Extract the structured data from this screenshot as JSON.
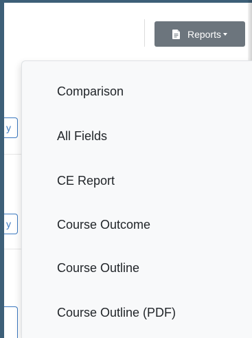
{
  "toolbar": {
    "reports_label": "Reports",
    "reports_icon": "document-icon",
    "reports_caret_icon": "caret-down-icon",
    "button_color": "#6c757d"
  },
  "left_partial": {
    "chip_1_text": "y",
    "chip_2_text": "y",
    "chip_3_text": "",
    "accent_color": "#3a78c0"
  },
  "dropdown": {
    "items": [
      {
        "label": "Comparison"
      },
      {
        "label": "All Fields"
      },
      {
        "label": "CE Report"
      },
      {
        "label": "Course Outcome"
      },
      {
        "label": "Course Outline"
      },
      {
        "label": "Course Outline (PDF)"
      }
    ]
  },
  "frame": {
    "border_color": "#3d5f78"
  }
}
